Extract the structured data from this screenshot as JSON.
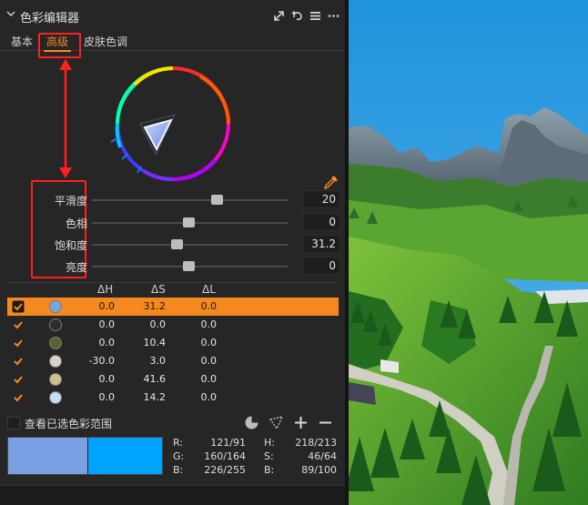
{
  "panel": {
    "title": "色彩编辑器",
    "tabs": [
      "基本",
      "高级",
      "皮肤色调"
    ],
    "active_tab": "高级"
  },
  "sliders": [
    {
      "label": "平滑度",
      "value": "20",
      "position": 0.63
    },
    {
      "label": "色相",
      "value": "0",
      "position": 0.5
    },
    {
      "label": "饱和度",
      "value": "31.2",
      "position": 0.43
    },
    {
      "label": "亮度",
      "value": "0",
      "position": 0.5
    }
  ],
  "table": {
    "headers": [
      "ΔH",
      "ΔS",
      "ΔL"
    ],
    "rows": [
      {
        "checked": true,
        "selected": true,
        "color": "#7aa6e0",
        "dh": "0.0",
        "ds": "31.2",
        "dl": "0.0"
      },
      {
        "checked": true,
        "selected": false,
        "color": "#2a2d2a",
        "dh": "0.0",
        "ds": "0.0",
        "dl": "0.0"
      },
      {
        "checked": true,
        "selected": false,
        "color": "#55642f",
        "dh": "0.0",
        "ds": "10.4",
        "dl": "0.0"
      },
      {
        "checked": true,
        "selected": false,
        "color": "#d8d2ca",
        "dh": "-30.0",
        "ds": "3.0",
        "dl": "0.0"
      },
      {
        "checked": true,
        "selected": false,
        "color": "#cbbf8d",
        "dh": "0.0",
        "ds": "41.6",
        "dl": "0.0"
      },
      {
        "checked": true,
        "selected": false,
        "color": "#c8def2",
        "dh": "0.0",
        "ds": "14.2",
        "dl": "0.0"
      }
    ]
  },
  "footer": {
    "view_range_label": "查看已选色彩范围"
  },
  "compare": {
    "before_color": "#79a0e2",
    "after_color": "#00a3ff",
    "readout": [
      {
        "k1": "R:",
        "v1": "121/91",
        "k2": "H:",
        "v2": "218/213"
      },
      {
        "k1": "G:",
        "v1": "160/164",
        "k2": "S:",
        "v2": "46/64"
      },
      {
        "k1": "B:",
        "v1": "226/255",
        "k2": "B:",
        "v2": "89/100"
      }
    ]
  },
  "colors": {
    "accent": "#f5891f",
    "annotation": "#ff1f1f"
  }
}
